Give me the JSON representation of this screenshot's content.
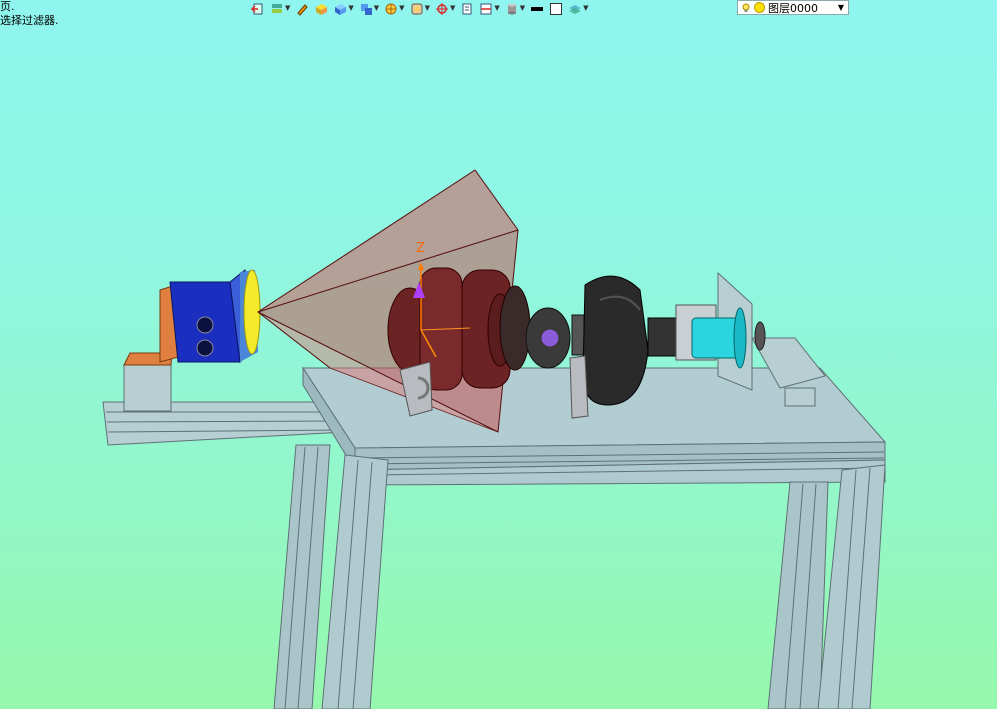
{
  "prompt": {
    "line1": "页.",
    "line2": "选择过滤器."
  },
  "toolbar": {
    "items": [
      {
        "icon": "exit-icon",
        "dropdown": false
      },
      {
        "icon": "layer-stack-icon",
        "dropdown": true
      },
      {
        "icon": "pencil-icon",
        "dropdown": false
      },
      {
        "icon": "box-solid-icon",
        "dropdown": false
      },
      {
        "icon": "blue-cube-icon",
        "dropdown": true
      },
      {
        "icon": "cube-stack-icon",
        "dropdown": true
      },
      {
        "icon": "sphere-section-icon",
        "dropdown": true
      },
      {
        "icon": "view-orient-icon",
        "dropdown": true
      },
      {
        "icon": "snap-point-icon",
        "dropdown": true
      },
      {
        "icon": "page-icon",
        "dropdown": false
      },
      {
        "icon": "section-plane-icon",
        "dropdown": true
      },
      {
        "icon": "cylinder-icon",
        "dropdown": true
      },
      {
        "icon": "black-line-icon",
        "dropdown": false
      },
      {
        "icon": "white-square-icon",
        "dropdown": false
      },
      {
        "icon": "layers-icon",
        "dropdown": true
      }
    ],
    "layer_combo": {
      "value": "图层0000",
      "bulb_icon": "lightbulb-icon",
      "state_icon": "sun-icon"
    }
  },
  "viewport": {
    "axis_label": "Z",
    "colors": {
      "bg_top": "#8ff5ee",
      "bg_bottom": "#95f8ac",
      "frame": "#a8c4c8",
      "frustum": "#d25a5a",
      "camera_body": "#1a2fbf",
      "lens": "#f2ea2a",
      "bracket": "#e08040",
      "crankshaft": "#6b2323",
      "dark_part": "#2a2a2a",
      "cyan_part": "#2ad5e0"
    }
  }
}
